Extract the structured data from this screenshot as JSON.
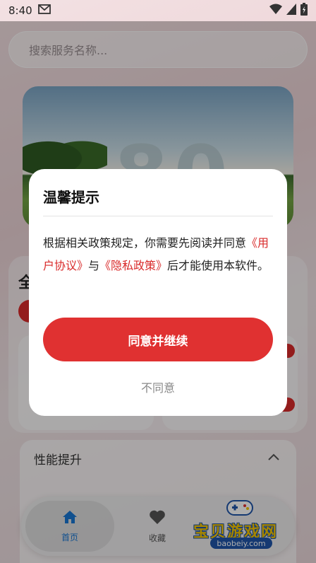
{
  "status_bar": {
    "time": "8:40",
    "icons": [
      "mail-icon",
      "wifi-icon",
      "signal-icon",
      "battery-icon"
    ]
  },
  "search": {
    "placeholder": "搜索服务名称..."
  },
  "banner": {
    "text": "80"
  },
  "background": {
    "section_title": "全",
    "perf_title": "性能提升"
  },
  "nav": {
    "items": [
      {
        "label": "首页",
        "icon": "home-icon"
      },
      {
        "label": "收藏",
        "icon": "heart-icon"
      }
    ]
  },
  "watermark": {
    "text": "宝贝游戏网",
    "url": "baobeiy.com"
  },
  "dialog": {
    "title": "温馨提示",
    "body_prefix": "根据相关政策规定，你需要先阅读并同意",
    "link_user": "《用户协议》",
    "body_and": "与",
    "link_privacy": "《隐私政策》",
    "body_suffix": "后才能使用本软件。",
    "agree": "同意并继续",
    "disagree": "不同意"
  },
  "colors": {
    "accent": "#e03131",
    "link": "#d92a2a",
    "nav_active": "#1976d2"
  }
}
